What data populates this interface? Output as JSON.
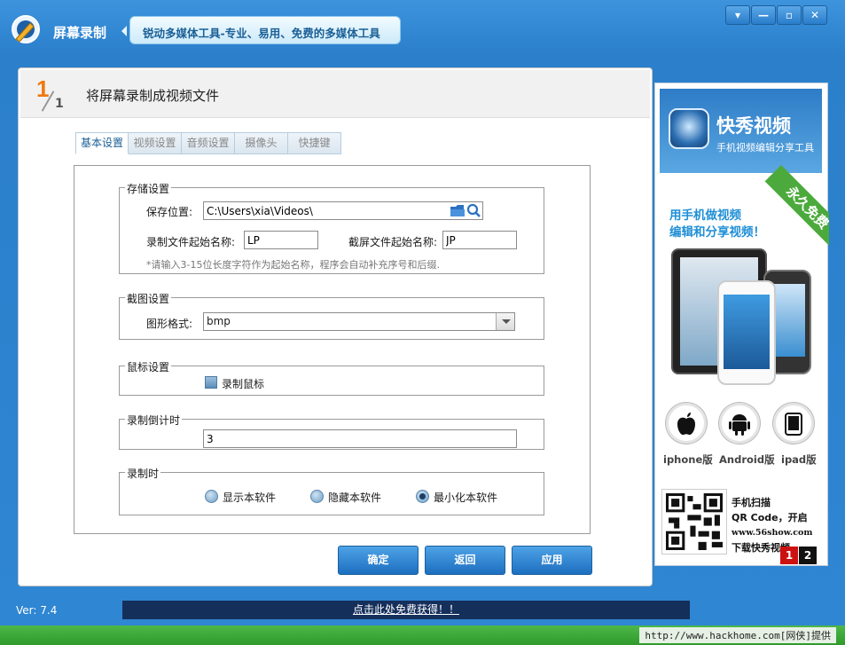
{
  "titlebar": {
    "app_title": "屏幕录制",
    "slogan": "锐动多媒体工具-专业、易用、免费的多媒体工具",
    "controls": [
      "▾",
      "—",
      "▫",
      "✕"
    ]
  },
  "step": {
    "number": "1",
    "total": "1",
    "title": "将屏幕录制成视频文件"
  },
  "tabs": [
    {
      "label": "基本设置",
      "active": true
    },
    {
      "label": "视频设置",
      "active": false
    },
    {
      "label": "音频设置",
      "active": false
    },
    {
      "label": "摄像头",
      "active": false
    },
    {
      "label": "快捷键",
      "active": false
    }
  ],
  "storage": {
    "legend": "存储设置",
    "path_label": "保存位置:",
    "path_value": "C:\\Users\\xia\\Videos\\",
    "record_prefix_label": "录制文件起始名称:",
    "record_prefix_value": "LP",
    "shot_prefix_label": "截屏文件起始名称:",
    "shot_prefix_value": "JP",
    "hint": "*请输入3-15位长度字符作为起始名称，程序会自动补充序号和后缀."
  },
  "screenshot": {
    "legend": "截图设置",
    "format_label": "图形格式:",
    "format_value": "bmp"
  },
  "mouse": {
    "legend": "鼠标设置",
    "record_mouse_label": "录制鼠标"
  },
  "countdown": {
    "legend": "录制倒计时",
    "value": "3"
  },
  "recording": {
    "legend": "录制时",
    "options": [
      "显示本软件",
      "隐藏本软件",
      "最小化本软件"
    ],
    "selected": "最小化本软件"
  },
  "buttons": {
    "ok": "确定",
    "back": "返回",
    "apply": "应用"
  },
  "ad": {
    "name": "快秀视频",
    "sub": "手机视频编辑分享工具",
    "ribbon": "永久免费",
    "slogan_line1": "用手机做视频",
    "slogan_line2": "编辑和分享视频！",
    "platforms": [
      "iphone版",
      "Android版",
      "ipad版"
    ],
    "qr_line1": "手机扫描",
    "qr_line2": "QR Code，开启",
    "qr_line3": "www.56show.com",
    "qr_line4": "下载快秀视频",
    "pages": [
      "1",
      "2"
    ]
  },
  "status": {
    "version": "Ver: 7.4",
    "promo": "点击此处免费获得！！",
    "credit": "http://www.hackhome.com[网侠]提供"
  },
  "colors": {
    "title_bar": "#2f86d2",
    "accent_orange": "#f07810",
    "button_blue": "#1d6fc0",
    "promo_bg": "#152f5b",
    "strip_green": "#3aa836",
    "page_active": "#cc1111"
  }
}
